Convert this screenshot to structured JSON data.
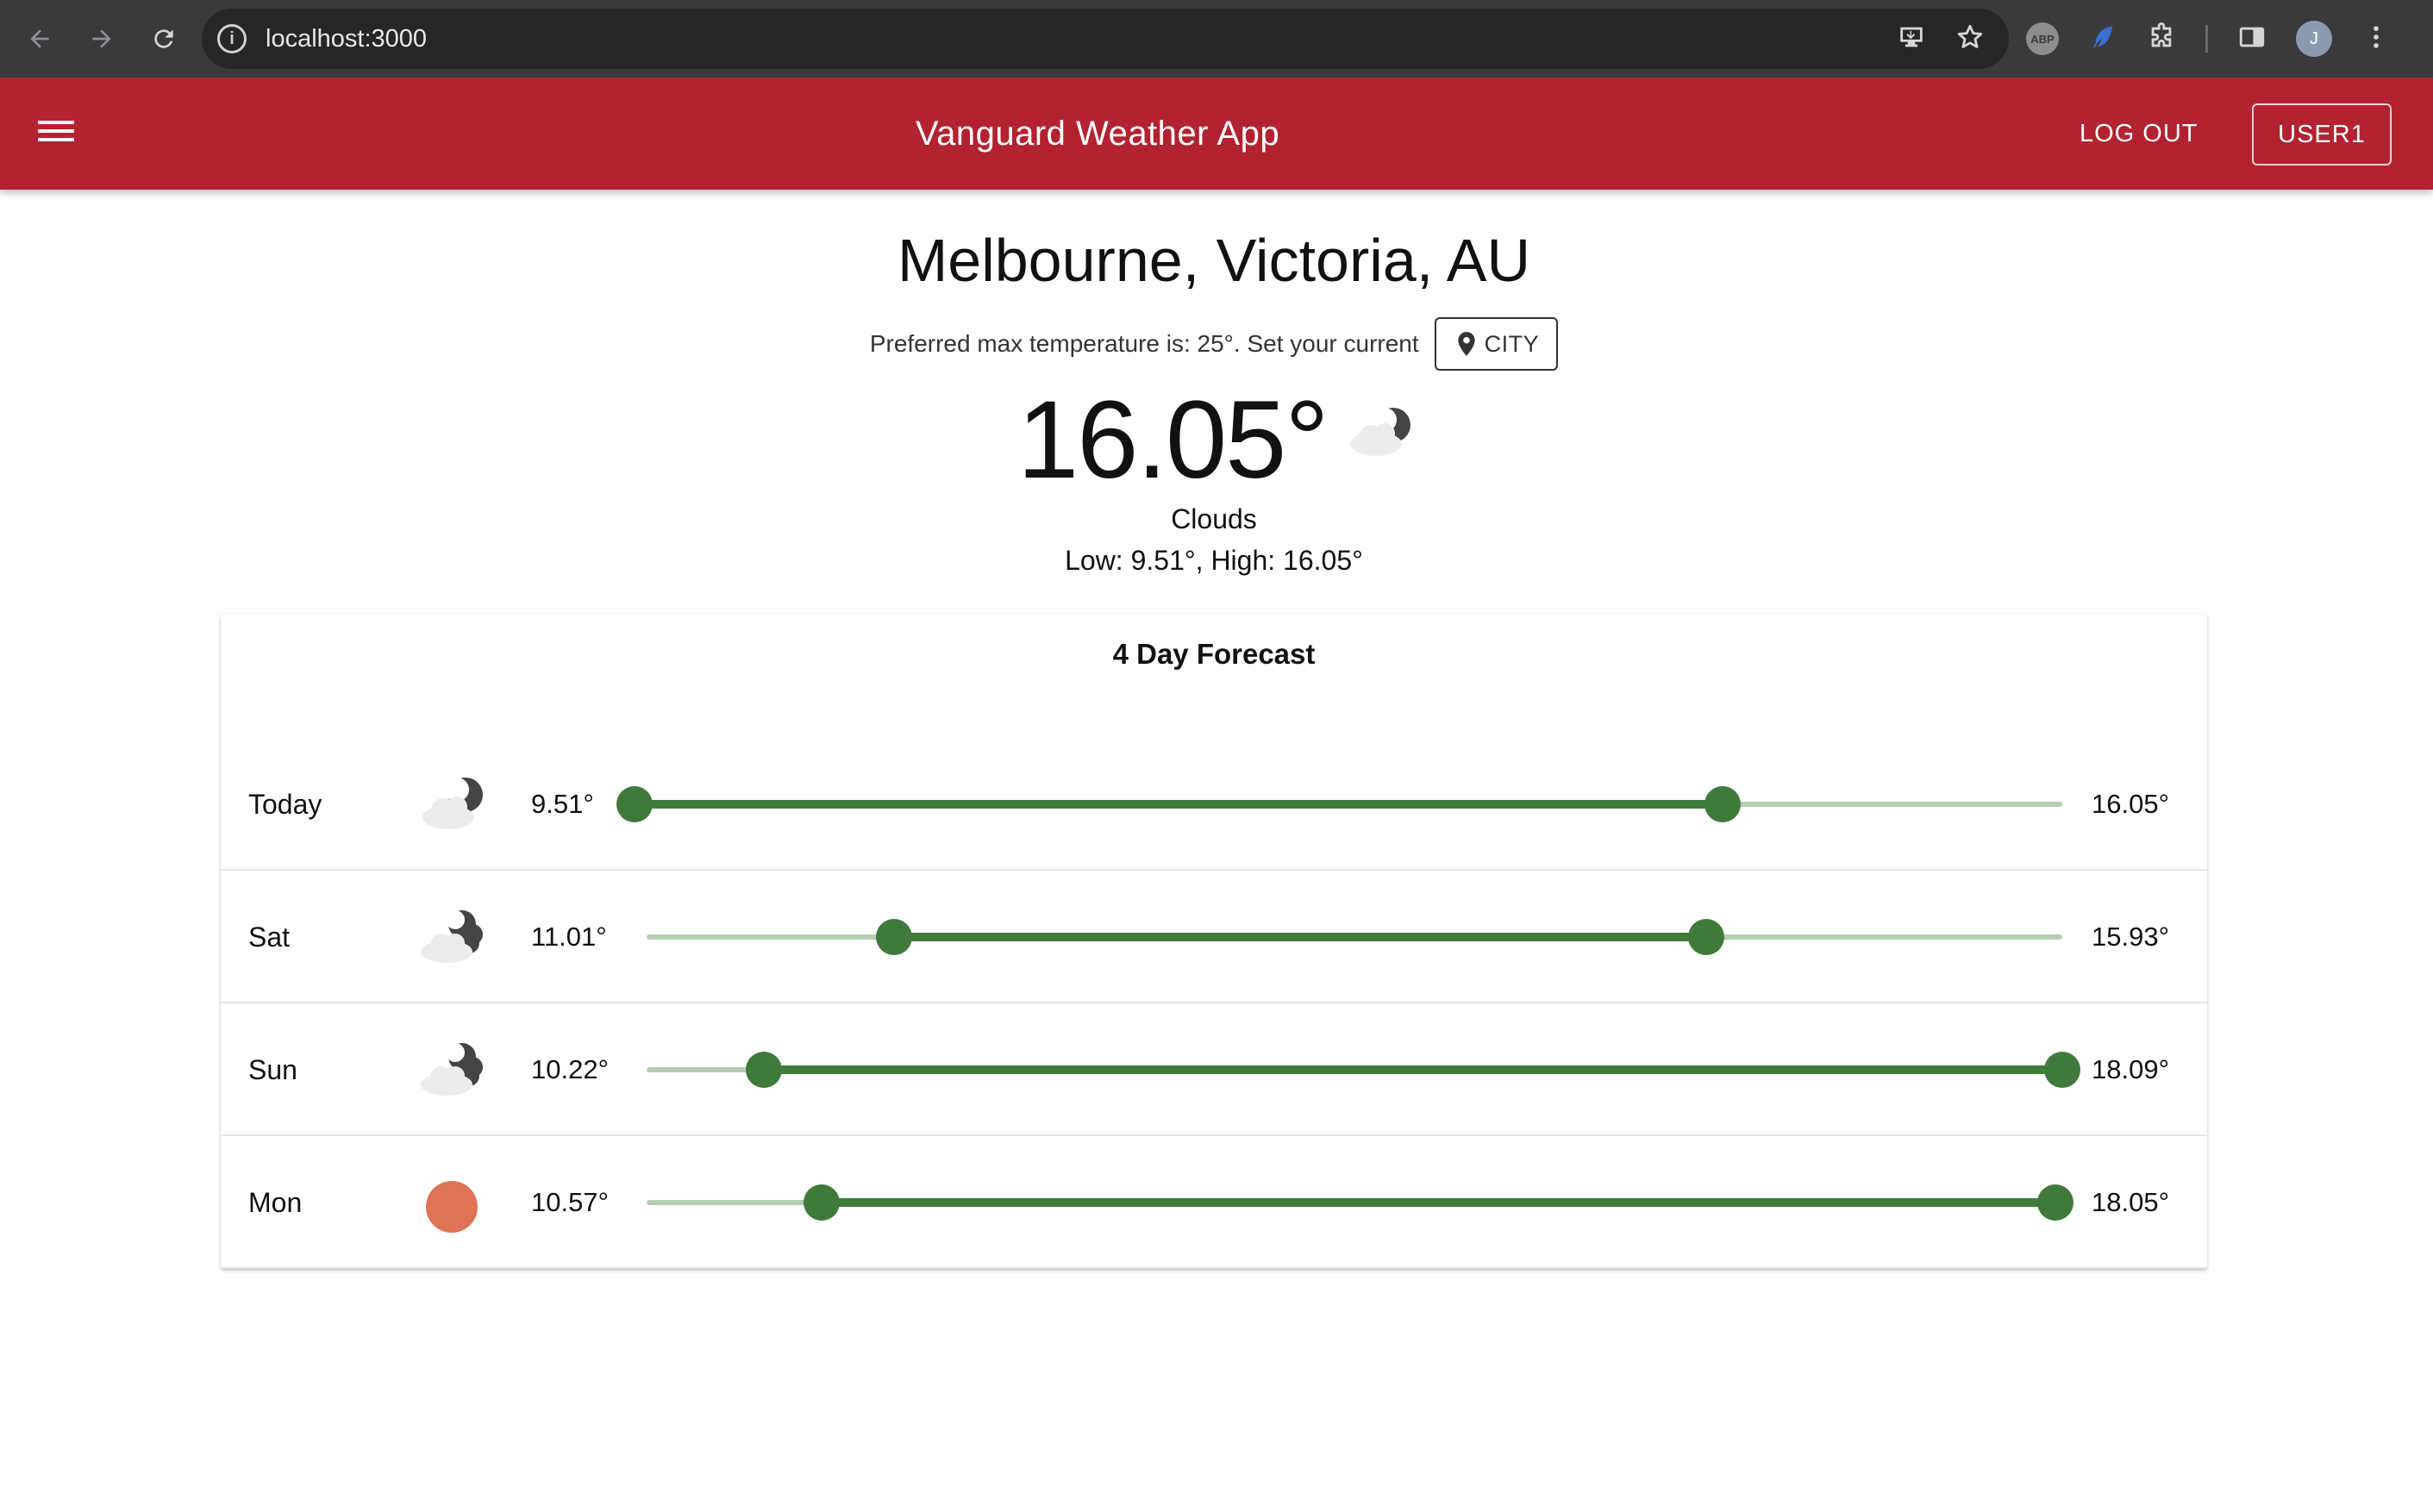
{
  "browser": {
    "url": "localhost:3000",
    "profile_initial": "J",
    "abp_label": "ABP"
  },
  "app_bar": {
    "title": "Vanguard Weather App",
    "logout_label": "LOG OUT",
    "user_label": "USER1",
    "background_color": "#b22230"
  },
  "location": {
    "name": "Melbourne, Victoria, AU",
    "preference_text": "Preferred max temperature is: 25°. Set your current",
    "city_button_label": "CITY"
  },
  "current": {
    "temperature": "16.05°",
    "condition": "Clouds",
    "condition_icon": "cloud-moon-icon",
    "low_high": "Low: 9.51°, High: 16.05°"
  },
  "forecast": {
    "title": "4 Day Forecast",
    "slider_range": [
      9.51,
      18.09
    ],
    "days": [
      {
        "day": "Today",
        "icon": "cloud-moon-icon",
        "low_label": "9.51°",
        "high_label": "16.05°",
        "low": 9.51,
        "high": 16.05
      },
      {
        "day": "Sat",
        "icon": "cloudy-moon-icon",
        "low_label": "11.01°",
        "high_label": "15.93°",
        "low": 11.01,
        "high": 15.93
      },
      {
        "day": "Sun",
        "icon": "cloudy-moon-icon",
        "low_label": "10.22°",
        "high_label": "18.09°",
        "low": 10.22,
        "high": 18.09
      },
      {
        "day": "Mon",
        "icon": "sun-icon",
        "low_label": "10.57°",
        "high_label": "18.05°",
        "low": 10.57,
        "high": 18.05
      }
    ]
  },
  "colors": {
    "slider_fill": "#3f7a3a",
    "slider_track": "#b7cdb3",
    "sun": "#e07255"
  }
}
